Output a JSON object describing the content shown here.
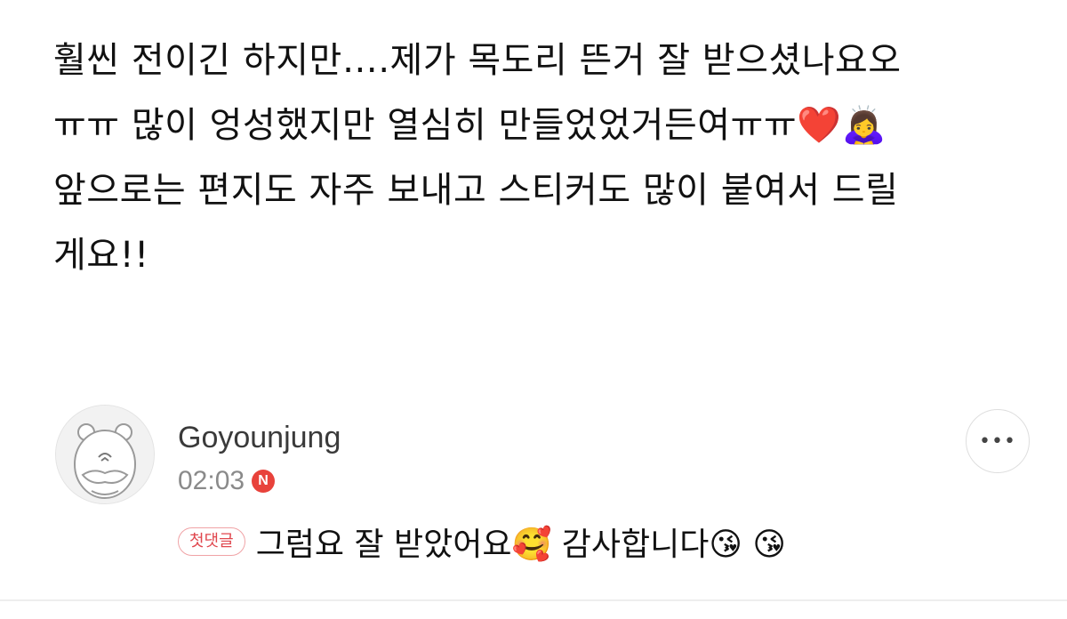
{
  "post": {
    "line1": "훨씬 전이긴 하지만….제가 목도리 뜬거 잘 받으셨나요오",
    "line2_text": "ㅠㅠ 많이 엉성했지만 열심히 만들었었거든여ㅠㅠ",
    "line2_emojis": "❤️🙇‍♀️",
    "line3": "앞으로는 편지도 자주 보내고 스티커도 많이 붙여서 드릴",
    "line4": "게요!!"
  },
  "comment": {
    "author": "Goyounjung",
    "time": "02:03",
    "new_badge": "N",
    "first_comment_badge": "첫댓글",
    "text": "그럼요 잘 받았어요🥰 감사합니다😘 😘",
    "more_label": "•••",
    "avatar_icon": "hamster-avatar-icon"
  },
  "colors": {
    "new_badge": "#e8423b",
    "first_badge_text": "#e0474e",
    "first_badge_border": "#f0a3a6"
  }
}
